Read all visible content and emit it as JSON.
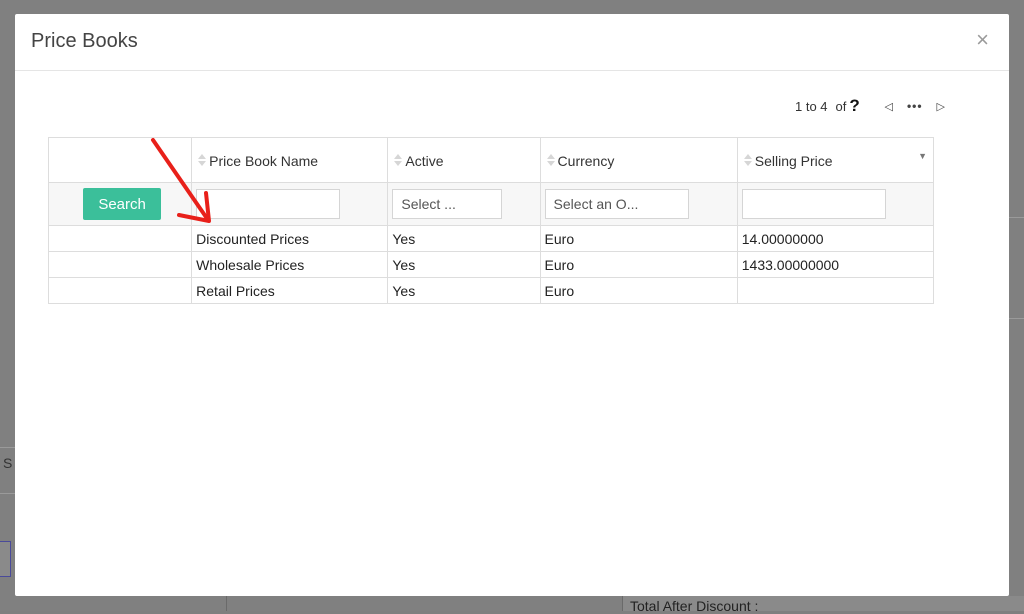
{
  "modal": {
    "title": "Price Books",
    "close_glyph": "×"
  },
  "pager": {
    "range": "1 to 4",
    "of": "of",
    "total": "?",
    "prev_glyph": "◁",
    "more_glyph": "•••",
    "next_glyph": "▷"
  },
  "grid": {
    "columns": [
      "Price Book Name",
      "Active",
      "Currency",
      "Selling Price"
    ],
    "search_label": "Search",
    "filters": {
      "name": "",
      "active": "Select ...",
      "currency": "Select an O...",
      "selling_price": ""
    },
    "rows": [
      {
        "name": "Discounted Prices",
        "active": "Yes",
        "currency": "Euro",
        "selling_price": "14.00000000"
      },
      {
        "name": "Wholesale Prices",
        "active": "Yes",
        "currency": "Euro",
        "selling_price": "1433.00000000"
      },
      {
        "name": "Retail Prices",
        "active": "Yes",
        "currency": "Euro",
        "selling_price": ""
      }
    ]
  },
  "background": {
    "s_fragment": "S",
    "total_after_discount": "Total After Discount :"
  },
  "colors": {
    "accent": "#3bbf9a",
    "annotation_arrow": "#e8201a"
  }
}
